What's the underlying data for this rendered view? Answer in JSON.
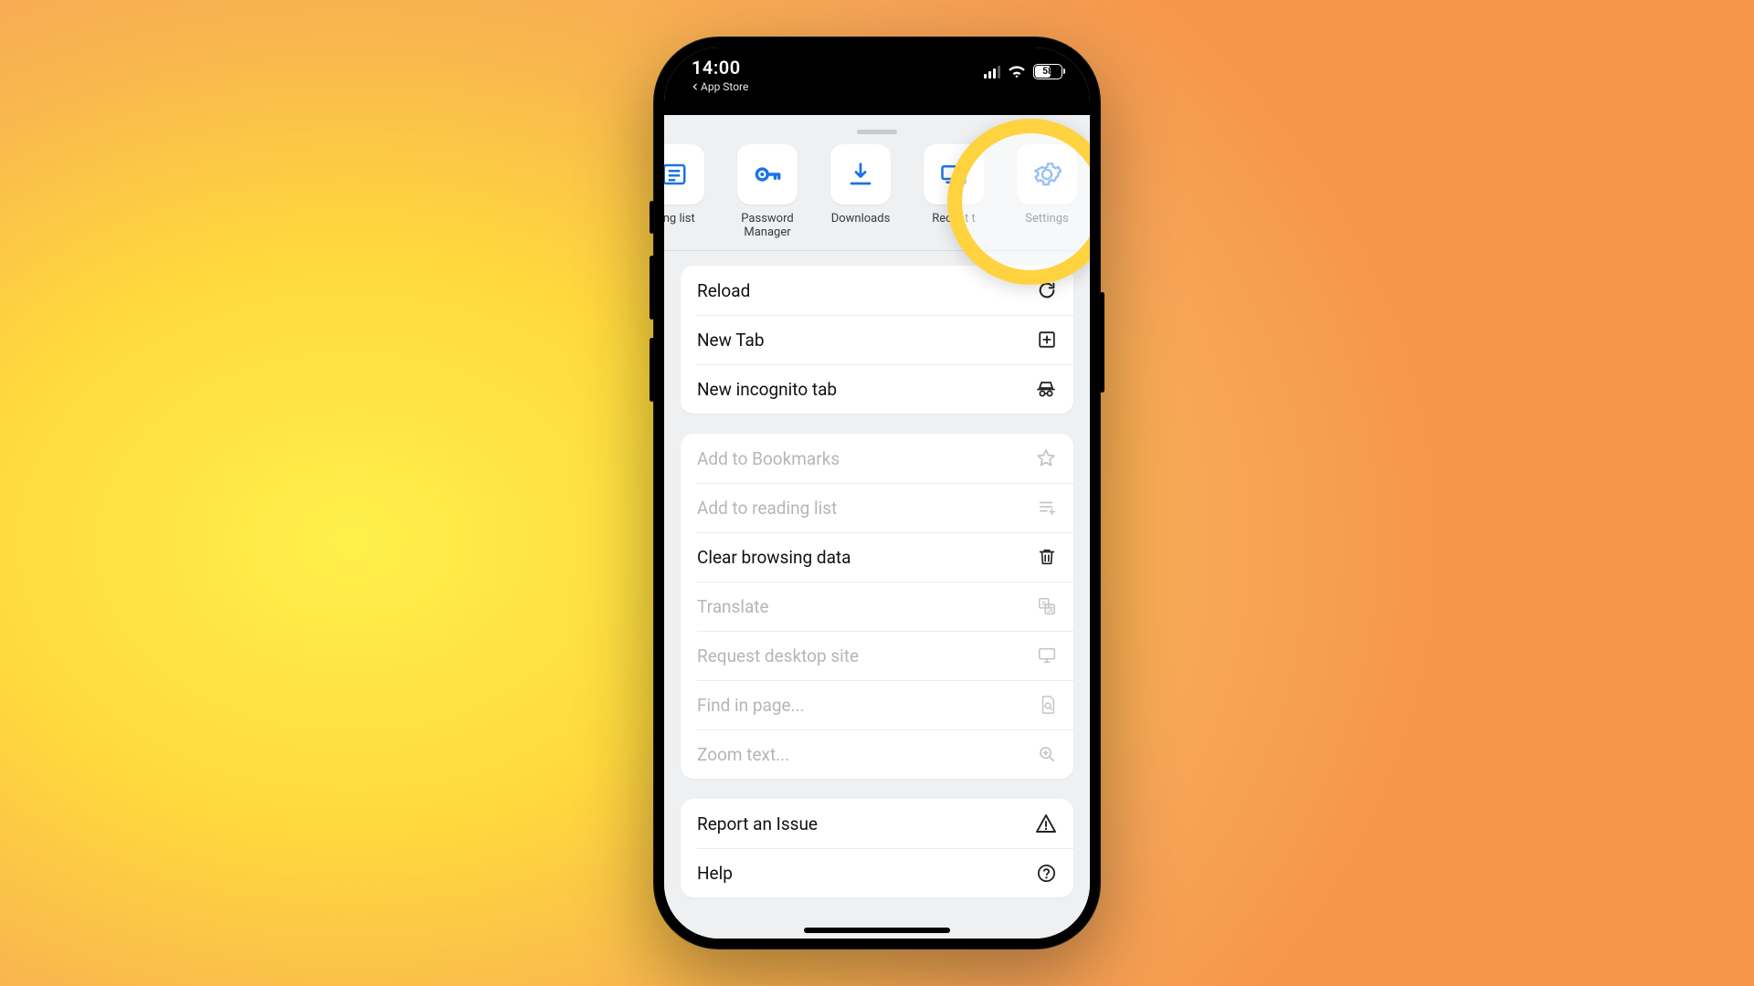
{
  "status": {
    "time": "14:00",
    "back_link": "App Store",
    "battery": "58"
  },
  "shortcuts": [
    {
      "id": "reading-list",
      "label": "ding list",
      "icon": "reading-list"
    },
    {
      "id": "password-manager",
      "label": "Password\nManager",
      "icon": "key"
    },
    {
      "id": "downloads",
      "label": "Downloads",
      "icon": "download"
    },
    {
      "id": "recent-tabs",
      "label": "Recent t",
      "icon": "devices"
    },
    {
      "id": "settings",
      "label": "Settings",
      "icon": "gear"
    }
  ],
  "group1": {
    "reload": "Reload",
    "new_tab": "New Tab",
    "incognito": "New incognito tab"
  },
  "group2": {
    "bookmarks": "Add to Bookmarks",
    "reading": "Add to reading list",
    "clear": "Clear browsing data",
    "translate": "Translate",
    "desktop": "Request desktop site",
    "find": "Find in page...",
    "zoom": "Zoom text..."
  },
  "group3": {
    "report": "Report an Issue",
    "help": "Help"
  },
  "highlight_target": "settings"
}
